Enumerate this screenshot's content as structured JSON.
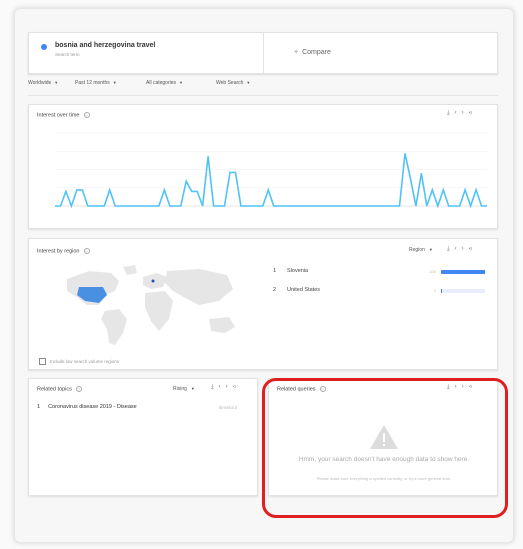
{
  "search_term": {
    "name": "bosnia and herzegovina travel",
    "sub": "Search term",
    "compare_label": "Compare"
  },
  "filters": {
    "region": "Worldwide",
    "time": "Past 12 months",
    "category": "All categories",
    "search_type": "Web Search"
  },
  "interest_over_time": {
    "title": "Interest over time"
  },
  "chart_data": {
    "type": "line",
    "title": "Interest over time",
    "series": [
      {
        "values": [
          0,
          0,
          20,
          0,
          22,
          22,
          0,
          0,
          0,
          0,
          22,
          0,
          0,
          0,
          0,
          0,
          0,
          0,
          0,
          0,
          22,
          0,
          0,
          0,
          34,
          20,
          20,
          0,
          68,
          0,
          0,
          0,
          46,
          46,
          0,
          0,
          0,
          0,
          0,
          22,
          0,
          0,
          0,
          0,
          0,
          0,
          0,
          0,
          0,
          0,
          0,
          0,
          0,
          0,
          0,
          0,
          0,
          0,
          0,
          0,
          0,
          0,
          0,
          0,
          72,
          38,
          0,
          45,
          0,
          22,
          0,
          22,
          0,
          0,
          0,
          22,
          0,
          22,
          0,
          0
        ]
      }
    ],
    "ylim": [
      0,
      100
    ],
    "grid": true,
    "colors": {
      "line": "#4fc3f7"
    }
  },
  "interest_by_region": {
    "title": "Interest by region",
    "selector": "Region",
    "rows": [
      {
        "rank": "1",
        "name": "Slovenia",
        "value": 100
      },
      {
        "rank": "2",
        "name": "United States",
        "value": 2
      }
    ],
    "checkbox_label": "Include low search volume regions"
  },
  "related_topics": {
    "title": "Related topics",
    "selector": "Rising",
    "items": [
      {
        "rank": "1",
        "name": "Coronavirus disease 2019 - Disease",
        "tag": "Breakout"
      }
    ]
  },
  "related_queries": {
    "title": "Related queries",
    "empty_main": "Hmm, your search doesn't have enough data to show here.",
    "empty_sub": "Please make sure everything is spelled correctly, or try a more general term."
  },
  "colors": {
    "accent": "#4285f4",
    "highlight": "#e02020"
  }
}
